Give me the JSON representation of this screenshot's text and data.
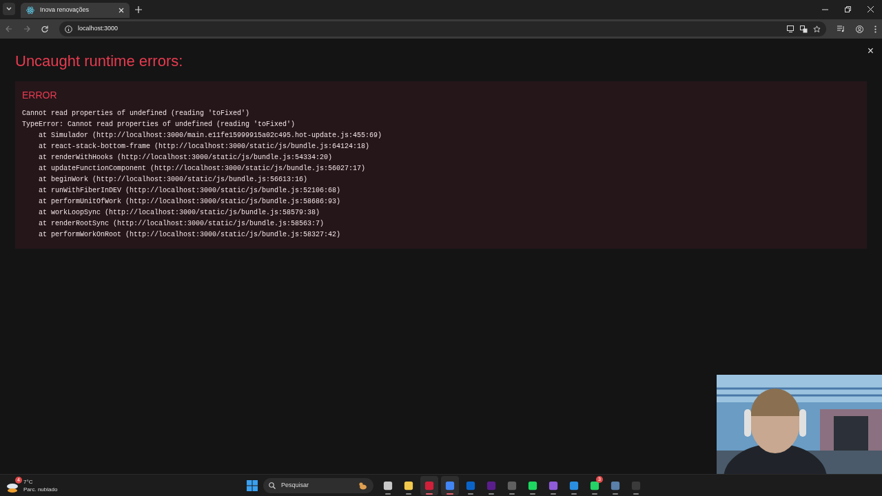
{
  "browser": {
    "tabs": [
      {
        "title": "Inova renovações",
        "selected": true
      }
    ],
    "address": "localhost:3000"
  },
  "overlay": {
    "title": "Uncaught runtime errors:",
    "close": "×",
    "errors": [
      {
        "label": "ERROR",
        "message": "Cannot read properties of undefined (reading 'toFixed')",
        "stack": [
          "TypeError: Cannot read properties of undefined (reading 'toFixed')",
          "    at Simulador (http://localhost:3000/main.e11fe15999915a02c495.hot-update.js:455:69)",
          "    at react-stack-bottom-frame (http://localhost:3000/static/js/bundle.js:64124:18)",
          "    at renderWithHooks (http://localhost:3000/static/js/bundle.js:54334:20)",
          "    at updateFunctionComponent (http://localhost:3000/static/js/bundle.js:56027:17)",
          "    at beginWork (http://localhost:3000/static/js/bundle.js:56613:16)",
          "    at runWithFiberInDEV (http://localhost:3000/static/js/bundle.js:52106:68)",
          "    at performUnitOfWork (http://localhost:3000/static/js/bundle.js:58686:93)",
          "    at workLoopSync (http://localhost:3000/static/js/bundle.js:58579:38)",
          "    at renderRootSync (http://localhost:3000/static/js/bundle.js:58563:7)",
          "    at performWorkOnRoot (http://localhost:3000/static/js/bundle.js:58327:42)"
        ]
      }
    ]
  },
  "taskbar": {
    "weather": {
      "temp": "7°C",
      "condition": "Parc. nublado",
      "badge": "4"
    },
    "search_placeholder": "Pesquisar",
    "apps": [
      {
        "color": "#c8c8c8",
        "active": false
      },
      {
        "color": "#f2c94c",
        "active": false
      },
      {
        "color": "#d0203a",
        "active": true
      },
      {
        "color": "#4285f4",
        "active": true
      },
      {
        "color": "#0a64c8",
        "active": false
      },
      {
        "color": "#5a1e8c",
        "active": false
      },
      {
        "color": "#606060",
        "active": false
      },
      {
        "color": "#1ed760",
        "active": false
      },
      {
        "color": "#8e5cd9",
        "active": false
      },
      {
        "color": "#2a8fe0",
        "active": false
      },
      {
        "color": "#25d366",
        "active": false,
        "badge": "3"
      },
      {
        "color": "#5a7fa8",
        "active": false
      },
      {
        "color": "#3a3a3a",
        "active": false
      }
    ]
  }
}
